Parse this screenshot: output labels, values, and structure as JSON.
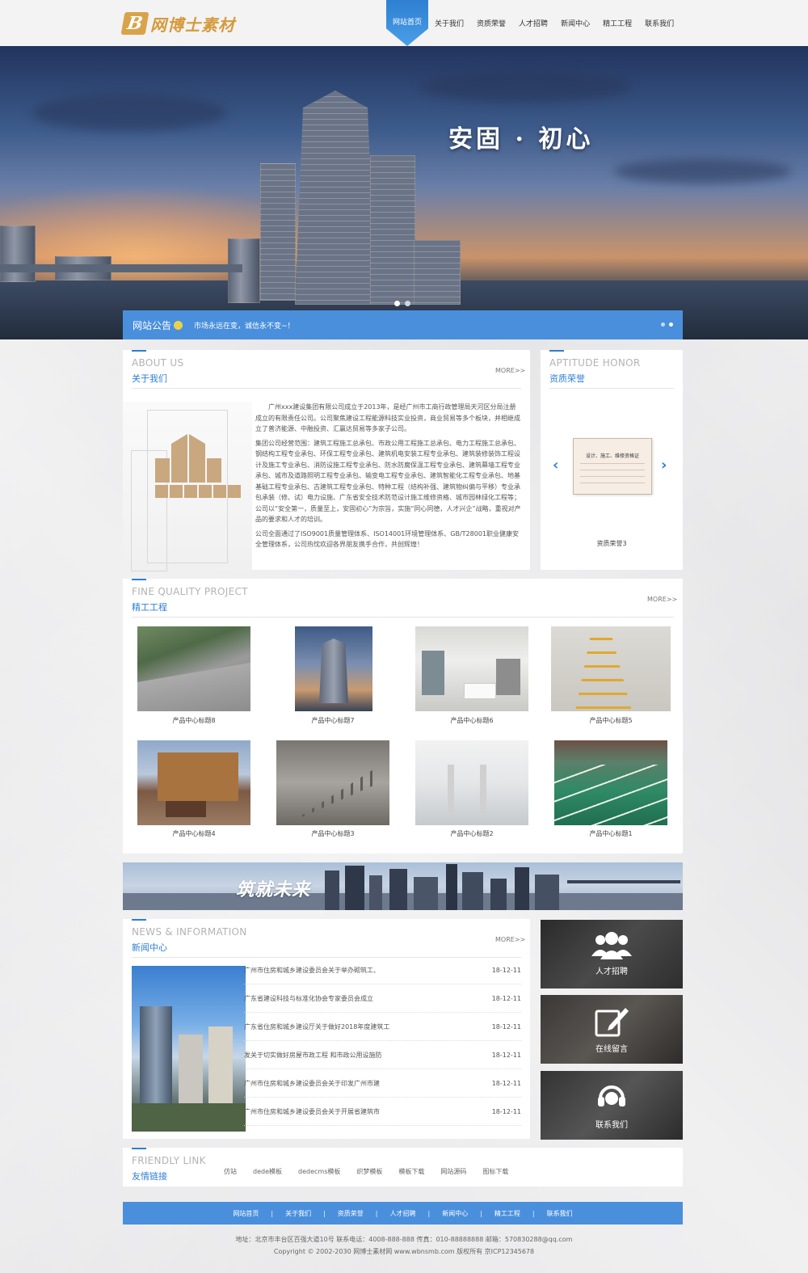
{
  "header": {
    "logo_text": "网博士素材",
    "nav": [
      "网站首页",
      "关于我们",
      "资质荣誉",
      "人才招聘",
      "新闻中心",
      "精工工程",
      "联系我们"
    ]
  },
  "banner": {
    "title": "安固 · 初心",
    "slides": 2,
    "active_slide": 1
  },
  "notice": {
    "label": "网站公告",
    "text": "市场永远在变，诚信永不变~！"
  },
  "about": {
    "title_en": "ABOUT US",
    "title_cn": "关于我们",
    "more": "MORE>>",
    "paragraphs": [
      "广州xxx建设集团有限公司成立于2013年，是经广州市工商行政管理局天河区分局注册成立的有限责任公司。公司聚焦建设工程能源科技实业投资，商业贸易等多个板块，并相继成立了普济能源、中融投资、汇赢达贸易等多家子公司。",
      "集团公司经营范围：建筑工程施工总承包、市政公用工程施工总承包、电力工程施工总承包、钢结构工程专业承包、环保工程专业承包、建筑机电安装工程专业承包、建筑装修装饰工程设计及施工专业承包、消防设施工程专业承包、防水防腐保温工程专业承包、建筑幕墙工程专业承包、城市及道路照明工程专业承包、输变电工程专业承包、建筑智能化工程专业承包、地基基础工程专业承包、古建筑工程专业承包、特种工程（结构补强、建筑物纠偏与平移）专业承包承装（修、试）电力设施、广东省安全技术防范设计施工维修资格、城市园林绿化工程等；公司以“安全第一，质量至上，安固初心”为宗旨，实施“同心同德，人才兴企”战略，重视对产品的要求和人才的培训。",
      "公司全面通过了ISO9001质量管理体系、ISO14001环境管理体系、GB/T28001职业健康安全管理体系，公司热忱欢迎各界朋友携手合作，共创辉煌！"
    ]
  },
  "honor": {
    "title_en": "APTITUDE HONOR",
    "title_cn": "资质荣誉",
    "cert_title": "设计、施工、维修资格证",
    "caption": "资质荣誉3"
  },
  "projects": {
    "title_en": "FINE QUALITY PROJECT",
    "title_cn": "精工工程",
    "more": "MORE>>",
    "items": [
      "产品中心标题8",
      "产品中心标题7",
      "产品中心标题6",
      "产品中心标题5",
      "产品中心标题4",
      "产品中心标题3",
      "产品中心标题2",
      "产品中心标题1"
    ]
  },
  "strip": {
    "slogan": "筑就未来"
  },
  "news": {
    "title_en": "NEWS & INFORMATION",
    "title_cn": "新闻中心",
    "more": "MORE>>",
    "items": [
      {
        "title": "广州市住房和城乡建设委员会关于举办砌筑工、",
        "date": "18-12-11"
      },
      {
        "title": "广东省建设科技与标准化协会专家委员会成立",
        "date": "18-12-11"
      },
      {
        "title": "广东省住房和城乡建设厅关于做好2018年度建筑工",
        "date": "18-12-11"
      },
      {
        "title": "发关于切实做好房屋市政工程 和市政公用设施防",
        "date": "18-12-11"
      },
      {
        "title": "广州市住房和城乡建设委员会关于印发广州市建",
        "date": "18-12-11"
      },
      {
        "title": "广州市住房和城乡建设委员会关于开展省建筑市",
        "date": "18-12-11"
      }
    ]
  },
  "side": {
    "jobs": "人才招聘",
    "message": "在线留言",
    "contact": "联系我们"
  },
  "friend_links": {
    "title_en": "FRIENDLY LINK",
    "title_cn": "友情链接",
    "items": [
      "仿站",
      "dede模板",
      "dedecms模板",
      "织梦模板",
      "模板下载",
      "网站源码",
      "图标下载"
    ]
  },
  "footer": {
    "links": [
      "网站首页",
      "关于我们",
      "资质荣誉",
      "人才招聘",
      "新闻中心",
      "精工工程",
      "联系我们"
    ],
    "address_line": "地址：北京市丰台区百强大道10号  联系电话：4008-888-888  传真：010-88888888  邮箱：570830288@qq.com",
    "copyright_line": "Copyright © 2002-2030 网博士素材网 www.wbnsmb.com 版权所有    京ICP12345678"
  },
  "colors": {
    "accent": "#2f7fd3",
    "notice_bar": "#4a8fdc",
    "logo": "#d59a3d"
  }
}
